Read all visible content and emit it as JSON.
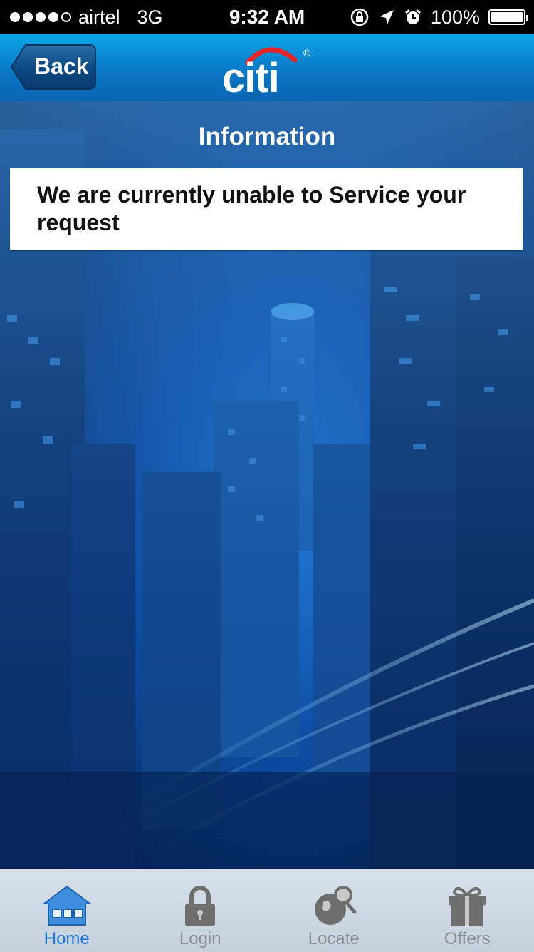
{
  "status_bar": {
    "carrier": "airtel",
    "network": "3G",
    "time": "9:32 AM",
    "battery_percent": "100%",
    "battery_level": 1.0
  },
  "header": {
    "back_label": "Back",
    "logo_text": "citi",
    "logo_registered": "®",
    "brand_colors": {
      "header_blue": "#0a78c6",
      "logo_arc": "#e3262b"
    }
  },
  "main": {
    "title": "Information",
    "message": "We are currently unable to Service your request"
  },
  "tab_bar": {
    "tabs": [
      {
        "label": "Home",
        "icon": "home-icon",
        "active": true
      },
      {
        "label": "Login",
        "icon": "lock-icon",
        "active": false
      },
      {
        "label": "Locate",
        "icon": "locate-icon",
        "active": false
      },
      {
        "label": "Offers",
        "icon": "gift-icon",
        "active": false
      }
    ],
    "active_color": "#1e78d6"
  }
}
